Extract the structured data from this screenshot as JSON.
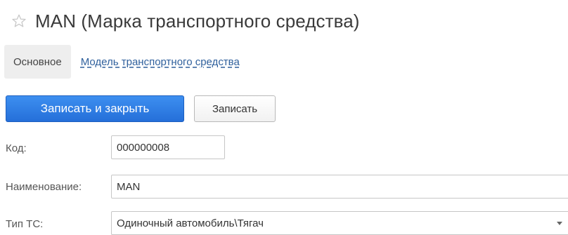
{
  "header": {
    "title": "MAN (Марка транспортного средства)",
    "favorite_icon": "star-outline-icon"
  },
  "nav": {
    "tabs": [
      {
        "label": "Основное",
        "active": true
      },
      {
        "label": "Модель транспортного средства",
        "active": false
      }
    ]
  },
  "toolbar": {
    "save_close_label": "Записать и закрыть",
    "save_label": "Записать"
  },
  "form": {
    "code": {
      "label": "Код:",
      "value": "000000008"
    },
    "name": {
      "label": "Наименование:",
      "value": "MAN"
    },
    "vehicle_type": {
      "label": "Тип ТС:",
      "value": "Одиночный автомобиль\\Тягач",
      "dropdown_icon": "chevron-down-icon"
    }
  },
  "colors": {
    "primary_button": "#2f7ee6",
    "link": "#2e5f9c",
    "star": "#c8c8c8"
  }
}
